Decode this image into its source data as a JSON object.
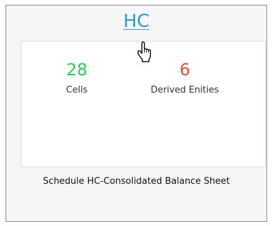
{
  "card": {
    "title": "HC",
    "cells_count": "28",
    "cells_label": "Cells",
    "derived_count": "6",
    "derived_label": "Derived Enities",
    "footer": "Schedule HC-Consolidated Balance Sheet"
  },
  "icons": {
    "cursor": "hand-pointer-icon"
  },
  "colors": {
    "link": "#2d9ad6",
    "cells_value": "#2ecc55",
    "derived_value": "#f04b3a",
    "card_bg": "#f6f6f6",
    "card_border": "#8a8a8a"
  }
}
